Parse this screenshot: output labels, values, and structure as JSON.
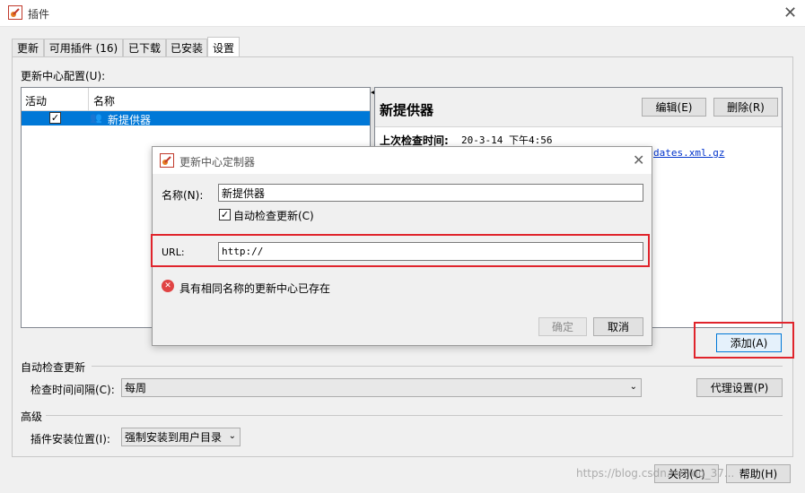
{
  "window": {
    "title": "插件"
  },
  "tabs": [
    {
      "label": "更新"
    },
    {
      "label": "可用插件 (16)"
    },
    {
      "label": "已下载"
    },
    {
      "label": "已安装"
    },
    {
      "label": "设置"
    }
  ],
  "update_center": {
    "section_label": "更新中心配置(U):",
    "columns": [
      "活动",
      "名称"
    ],
    "rows": [
      {
        "active": true,
        "name": "新提供器"
      }
    ],
    "detail_title": "新提供器",
    "edit_button": "编辑(E)",
    "delete_button": "删除(R)",
    "last_check_label": "上次检查时间:",
    "last_check_value": "20-3-14 下午4:56",
    "url_fragment": "dates.xml.gz",
    "add_button": "添加(A)"
  },
  "auto_check": {
    "section_label": "自动检查更新",
    "interval_label": "检查时间间隔(C):",
    "interval_value": "每周",
    "proxy_button": "代理设置(P)"
  },
  "advanced": {
    "section_label": "高级",
    "install_location_label": "插件安装位置(I):",
    "install_location_value": "强制安装到用户目录"
  },
  "footer": {
    "close_button": "关闭(C)",
    "help_button": "帮助(H)",
    "watermark": "https://blog.csdn.net/qq_37..."
  },
  "dialog": {
    "title": "更新中心定制器",
    "name_label": "名称(N):",
    "name_value": "新提供器",
    "auto_check_label": "自动检查更新(C)",
    "auto_check_checked": true,
    "url_label": "URL:",
    "url_value": "http://",
    "error_message": "具有相同名称的更新中心已存在",
    "ok_button": "确定",
    "cancel_button": "取消"
  },
  "colors": {
    "selection": "#0078d7",
    "highlight_box": "#e0242c",
    "error_icon": "#e04343"
  }
}
